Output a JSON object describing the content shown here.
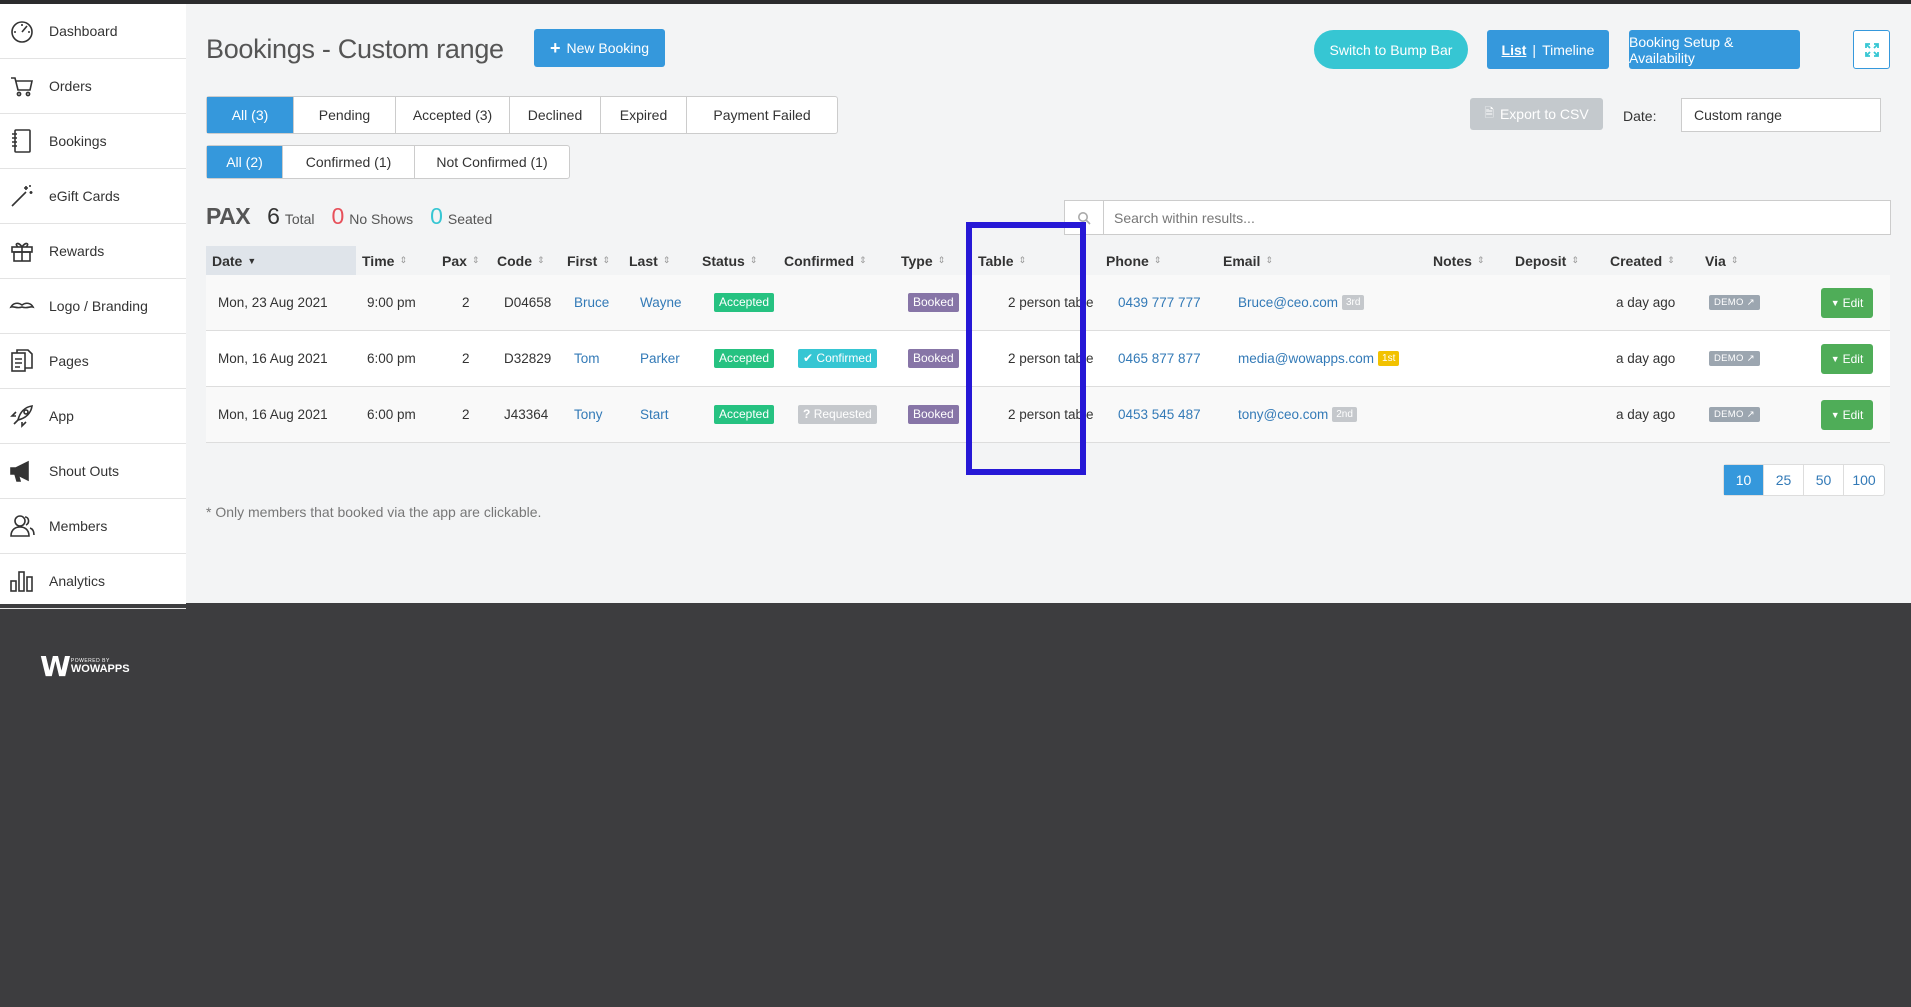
{
  "sidebar": {
    "items": [
      {
        "label": "Dashboard",
        "icon": "gauge-icon"
      },
      {
        "label": "Orders",
        "icon": "cart-icon"
      },
      {
        "label": "Bookings",
        "icon": "notebook-icon"
      },
      {
        "label": "eGift Cards",
        "icon": "magic-wand-icon"
      },
      {
        "label": "Rewards",
        "icon": "gift-icon"
      },
      {
        "label": "Logo / Branding",
        "icon": "mustache-icon"
      },
      {
        "label": "Pages",
        "icon": "pages-icon"
      },
      {
        "label": "App",
        "icon": "rocket-icon"
      },
      {
        "label": "Shout Outs",
        "icon": "megaphone-icon"
      },
      {
        "label": "Members",
        "icon": "members-icon"
      },
      {
        "label": "Analytics",
        "icon": "bar-chart-icon"
      }
    ],
    "powered_small": "POWERED BY",
    "powered_big": "WOWAPPS"
  },
  "header": {
    "title": "Bookings - Custom range",
    "new_booking": "New Booking",
    "bump_bar": "Switch to Bump Bar",
    "list": "List",
    "separator": "|",
    "timeline": "Timeline",
    "setup": "Booking Setup & Availability"
  },
  "filters": {
    "status_tabs": [
      "All (3)",
      "Pending",
      "Accepted (3)",
      "Declined",
      "Expired",
      "Payment Failed"
    ],
    "confirm_tabs": [
      "All (2)",
      "Confirmed (1)",
      "Not Confirmed (1)"
    ]
  },
  "export_label": "Export to CSV",
  "date": {
    "label": "Date:",
    "value": "Custom range"
  },
  "pax": {
    "label": "PAX",
    "total": "6",
    "total_label": "Total",
    "noshows": "0",
    "noshows_label": "No Shows",
    "seated": "0",
    "seated_label": "Seated"
  },
  "search": {
    "placeholder": "Search within results..."
  },
  "table": {
    "columns": [
      "Date",
      "Time",
      "Pax",
      "Code",
      "First",
      "Last",
      "Status",
      "Confirmed",
      "Type",
      "Table",
      "Phone",
      "Email",
      "Notes",
      "Deposit",
      "Created",
      "Via"
    ],
    "rows": [
      {
        "date": "Mon, 23 Aug 2021",
        "time": "9:00 pm",
        "pax": "2",
        "code": "D04658",
        "first": "Bruce",
        "last": "Wayne",
        "status": "Accepted",
        "confirmed": "",
        "type": "Booked",
        "table": "2 person table",
        "phone": "0439 777 777",
        "email": "Bruce@ceo.com",
        "email_badge": "3rd",
        "notes": "",
        "deposit": "",
        "created": "a day ago",
        "via": "DEMO",
        "edit": "Edit"
      },
      {
        "date": "Mon, 16 Aug 2021",
        "time": "6:00 pm",
        "pax": "2",
        "code": "D32829",
        "first": "Tom",
        "last": "Parker",
        "status": "Accepted",
        "confirmed": "Confirmed",
        "type": "Booked",
        "table": "2 person table",
        "phone": "0465 877 877",
        "email": "media@wowapps.com",
        "email_badge": "1st",
        "notes": "",
        "deposit": "",
        "created": "a day ago",
        "via": "DEMO",
        "edit": "Edit"
      },
      {
        "date": "Mon, 16 Aug 2021",
        "time": "6:00 pm",
        "pax": "2",
        "code": "J43364",
        "first": "Tony",
        "last": "Start",
        "status": "Accepted",
        "confirmed": "Requested",
        "type": "Booked",
        "table": "2 person table",
        "phone": "0453 545 487",
        "email": "tony@ceo.com",
        "email_badge": "2nd",
        "notes": "",
        "deposit": "",
        "created": "a day ago",
        "via": "DEMO",
        "edit": "Edit"
      }
    ]
  },
  "pager": [
    "10",
    "25",
    "50",
    "100"
  ],
  "footnote": "* Only members that booked via the app are clickable.",
  "colors": {
    "primary": "#3598dc",
    "teal": "#36c6d3",
    "green": "#26c281",
    "purple": "#8775a7",
    "red": "#e7505a",
    "highlight": "#2618d6"
  }
}
